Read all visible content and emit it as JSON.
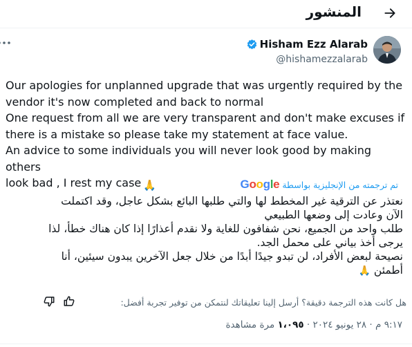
{
  "header": {
    "title": "المنشور",
    "back_icon": "back-arrow-icon"
  },
  "author": {
    "name": "Hisham Ezz Alarab",
    "handle": "@hishamezzalarab",
    "verified_color": "#1d9bf0"
  },
  "tweet": {
    "text": "Our apologies for unplanned upgrade that was urgently required by the\nvendor it's now completed and back to normal\nOne request from all we are very transparent and don't make excuses if\nthere is a mistake so please take my statement at face value.\nAn advice to some individuals you will never look good by making others\nlook bad , I rest my case",
    "emoji": "🙏"
  },
  "translation": {
    "label": "تم ترجمته من الإنجليزية بواسطة",
    "provider": "Google",
    "text": "نعتذر عن الترقية غير المخطط لها والتي طلبها البائع بشكل عاجل، وقد اكتملت\nالآن وعادت إلى وضعها الطبيعي\nطلب واحد من الجميع، نحن شفافون للغاية ولا نقدم أعذارًا إذا كان هناك خطأ، لذا\nيرجى أخذ بياني على محمل الجد.\nنصيحة لبعض الأفراد، لن تبدو جيدًا أبدًا من خلال جعل الآخرين يبدون سيئين، أنا\nأطمئن"
  },
  "feedback": {
    "question": "هل كانت هذه الترجمة دقيقة؟ أرسل إلينا تعليقاتك لنتمكن من توفير تجربة أفضل:"
  },
  "meta": {
    "time": "٩:١٧ م",
    "date": "٢٨ يونيو ٢٠٢٤",
    "views_count": "١،٠٩٥",
    "views_label": "مرة مشاهدة"
  }
}
